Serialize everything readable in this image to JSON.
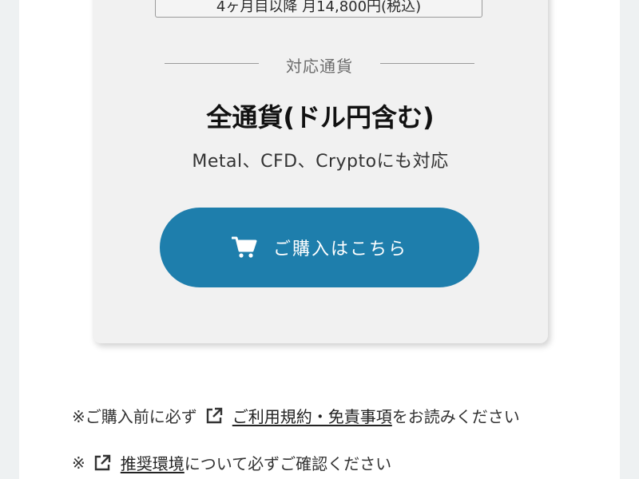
{
  "plan": {
    "price_text": "4ヶ月目以降 月14,800円(税込)"
  },
  "currency_section": {
    "heading": "対応通貨",
    "main": "全通貨(ドル円含む)",
    "sub": "Metal、CFD、Cryptoにも対応"
  },
  "purchase_button": {
    "label": "ご購入はこちら",
    "icon": "cart-icon",
    "color": "#1e7eac"
  },
  "notes": [
    {
      "prefix": "※ご購入前に必ず",
      "link_text": "ご利用規約・免責事項",
      "suffix": "をお読みください",
      "icon": "external-link-icon"
    },
    {
      "prefix": "※",
      "link_text": "推奨環境",
      "suffix": "について必ずご確認ください",
      "icon": "external-link-icon"
    }
  ]
}
